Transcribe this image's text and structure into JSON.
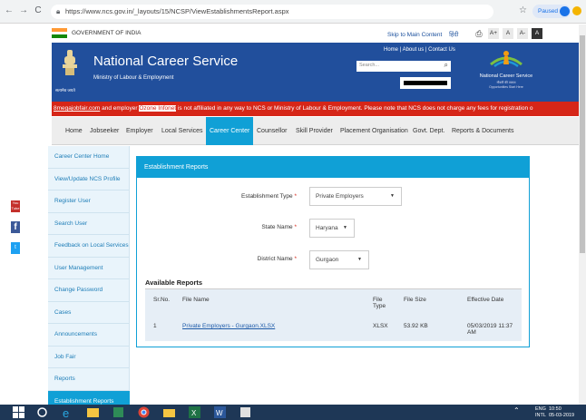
{
  "browser": {
    "url": "https://www.ncs.gov.in/_layouts/15/NCSP/ViewEstablishmentsReport.aspx",
    "profile_label": "Paused"
  },
  "govbar": {
    "text": "GOVERNMENT OF INDIA",
    "skip": "Skip to Main Content",
    "hindi": "हिंदी",
    "font_buttons": [
      "A+",
      "A",
      "A-",
      "A"
    ]
  },
  "header": {
    "title": "National Career Service",
    "subtitle": "Ministry of Labour & Employment",
    "emblem_text": "सत्यमेव जयते",
    "top_links": "Home | About us | Contact Us",
    "search_placeholder": "Search...",
    "logo_text": "National Career Service",
    "logo_subtext": "नौकरी की तलाश",
    "logo_tag": "Opportunities Start Here"
  },
  "ticker": {
    "site1": "8megajobfair.com",
    "middle": " and employer ",
    "site2": "Ozone Infonet",
    "rest": " is not affiliated in any way to NCS or Ministry of Labour & Employment. Please note that NCS does not charge any fees for registration o"
  },
  "nav": {
    "items": [
      "Home",
      "Jobseeker",
      "Employer",
      "Local Services",
      "Career Center",
      "Counsellor",
      "Skill Provider",
      "Placement Organisation",
      "Govt. Dept.",
      "Reports & Documents"
    ],
    "active": "Career Center"
  },
  "sidebar": {
    "items": [
      "Career Center Home",
      "View/Update NCS Profile",
      "Register User",
      "Search User",
      "Feedback on Local Services",
      "User Management",
      "Change Password",
      "Cases",
      "Announcements",
      "Job Fair",
      "Reports",
      "Establishment Reports"
    ]
  },
  "social": {
    "youtube": "You Tube",
    "facebook": "f",
    "twitter": "t"
  },
  "panel": {
    "title": "Establishment Reports",
    "fields": {
      "establishment_type": {
        "label": "Establishment Type",
        "value": "Private Employers"
      },
      "state": {
        "label": "State Name",
        "value": "Haryana"
      },
      "district": {
        "label": "District Name",
        "value": "Gurgaon"
      }
    },
    "required_mark": "*",
    "available_title": "Available Reports",
    "table": {
      "headers": [
        "Sr.No.",
        "File Name",
        "File Type",
        "File Size",
        "Effective Date"
      ],
      "rows": [
        {
          "sr": "1",
          "file_name": "Private Employers - Gurgaon.XLSX",
          "file_type": "XLSX",
          "file_size": "53.92 KB",
          "effective_date": "05/03/2019 11:37 AM"
        }
      ]
    }
  },
  "taskbar": {
    "lang": "ENG",
    "region": "INTL",
    "time": "10:50",
    "date": "05-03-2019"
  },
  "colors": {
    "header_blue": "#214f9c",
    "accent_cyan": "#10a0d6",
    "ticker_red": "#d62618"
  }
}
